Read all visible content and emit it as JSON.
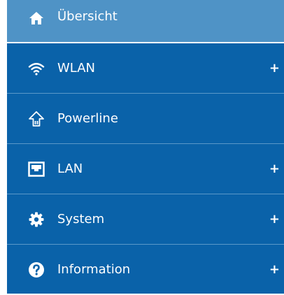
{
  "menu": {
    "items": [
      {
        "label": "Übersicht",
        "icon": "home-icon",
        "active": true,
        "expandable": false,
        "expand_symbol": ""
      },
      {
        "label": "WLAN",
        "icon": "wifi-icon",
        "active": false,
        "expandable": true,
        "expand_symbol": "+"
      },
      {
        "label": "Powerline",
        "icon": "powerline-icon",
        "active": false,
        "expandable": false,
        "expand_symbol": ""
      },
      {
        "label": "LAN",
        "icon": "ethernet-port-icon",
        "active": false,
        "expandable": true,
        "expand_symbol": "+"
      },
      {
        "label": "System",
        "icon": "gear-icon",
        "active": false,
        "expandable": true,
        "expand_symbol": "+"
      },
      {
        "label": "Information",
        "icon": "help-icon",
        "active": false,
        "expandable": true,
        "expand_symbol": "+"
      }
    ]
  },
  "colors": {
    "background": "#0a62a9",
    "active_background": "#4f93c6",
    "separator": "#5a98c9",
    "text": "#ffffff"
  }
}
